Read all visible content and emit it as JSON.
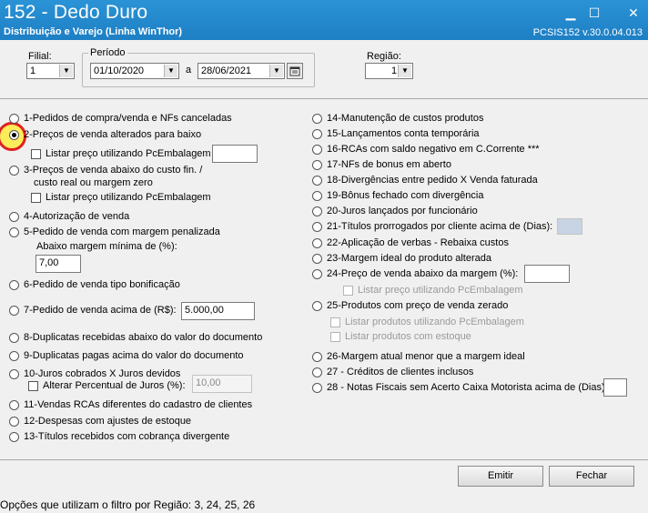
{
  "window": {
    "title": "152 - Dedo Duro",
    "subtitle": "Distribuição e Varejo (Linha WinThor)",
    "version": "PCSIS152  v.30.0.04.013",
    "controls": {
      "minimize": "▁",
      "maximize": "☐",
      "close": "✕"
    }
  },
  "filters": {
    "filial_label": "Filial:",
    "filial_value": "1",
    "periodo_label": "Período",
    "date_start": "01/10/2020",
    "date_sep": "a",
    "date_end": "28/06/2021",
    "regiao_label": "Região:",
    "regiao_value": "1"
  },
  "left_options": [
    {
      "label": "1-Pedidos de compra/venda e NFs canceladas",
      "checked": false
    },
    {
      "label": "2-Preços de venda alterados para baixo",
      "checked": true
    },
    {
      "label": "3-Preços de venda abaixo do custo fin. /",
      "checked": false
    },
    {
      "label": "4-Autorização de venda",
      "checked": false
    },
    {
      "label": "5-Pedido de venda com margem penalizada",
      "checked": false
    },
    {
      "label": "6-Pedido de venda tipo bonificação",
      "checked": false
    },
    {
      "label": "7-Pedido de venda acima de (R$):",
      "checked": false
    },
    {
      "label": "8-Duplicatas recebidas abaixo do valor do documento",
      "checked": false
    },
    {
      "label": "9-Duplicatas pagas acima do valor do documento",
      "checked": false
    },
    {
      "label": "10-Juros cobrados X Juros devidos",
      "checked": false
    },
    {
      "label": "11-Vendas RCAs diferentes do cadastro de clientes",
      "checked": false
    },
    {
      "label": "12-Despesas com ajustes de estoque",
      "checked": false
    },
    {
      "label": "13-Títulos recebidos com cobrança divergente",
      "checked": false
    }
  ],
  "left_extras": {
    "opt2_check": "Listar preço utilizando PcEmbalagem",
    "opt3_line2": "custo real ou margem zero",
    "opt3_check": "Listar preço utilizando PcEmbalagem",
    "opt5_sub": "Abaixo margem mínima de (%):",
    "opt5_value": "7,00",
    "opt7_value": "5.000,00",
    "opt10_check": "Alterar Percentual de Juros (%):",
    "opt10_value": "10,00"
  },
  "right_options": [
    {
      "label": "14-Manutenção de custos produtos",
      "checked": false
    },
    {
      "label": "15-Lançamentos conta temporária",
      "checked": false
    },
    {
      "label": "16-RCAs com saldo negativo em C.Corrente ***",
      "checked": false
    },
    {
      "label": "17-NFs de bonus em aberto",
      "checked": false
    },
    {
      "label": "18-Divergências entre pedido X Venda faturada",
      "checked": false
    },
    {
      "label": "19-Bônus fechado com divergência",
      "checked": false
    },
    {
      "label": "20-Juros lançados por funcionário",
      "checked": false
    },
    {
      "label": "21-Títulos prorrogados por cliente acima de (Dias):",
      "checked": false
    },
    {
      "label": "22-Aplicação de verbas - Rebaixa custos",
      "checked": false
    },
    {
      "label": "23-Margem ideal do produto alterada",
      "checked": false
    },
    {
      "label": "24-Preço de venda abaixo da margem (%):",
      "checked": false
    },
    {
      "label": "25-Produtos com preço de venda zerado",
      "checked": false
    },
    {
      "label": "26-Margem atual menor que a margem ideal",
      "checked": false
    },
    {
      "label": "27 - Créditos de clientes inclusos",
      "checked": false
    },
    {
      "label": "28 - Notas Fiscais sem Acerto Caixa Motorista acima de (Dias):",
      "checked": false
    }
  ],
  "right_extras": {
    "opt24_check": "Listar preço utilizando PcEmbalagem",
    "opt25_check1": "Listar produtos utilizando PcEmbalagem",
    "opt25_check2": "Listar produtos com estoque"
  },
  "buttons": {
    "emitir": "Emitir",
    "fechar": "Fechar"
  },
  "status": "Opções que utilizam o filtro por Região: 3, 24, 25, 26"
}
